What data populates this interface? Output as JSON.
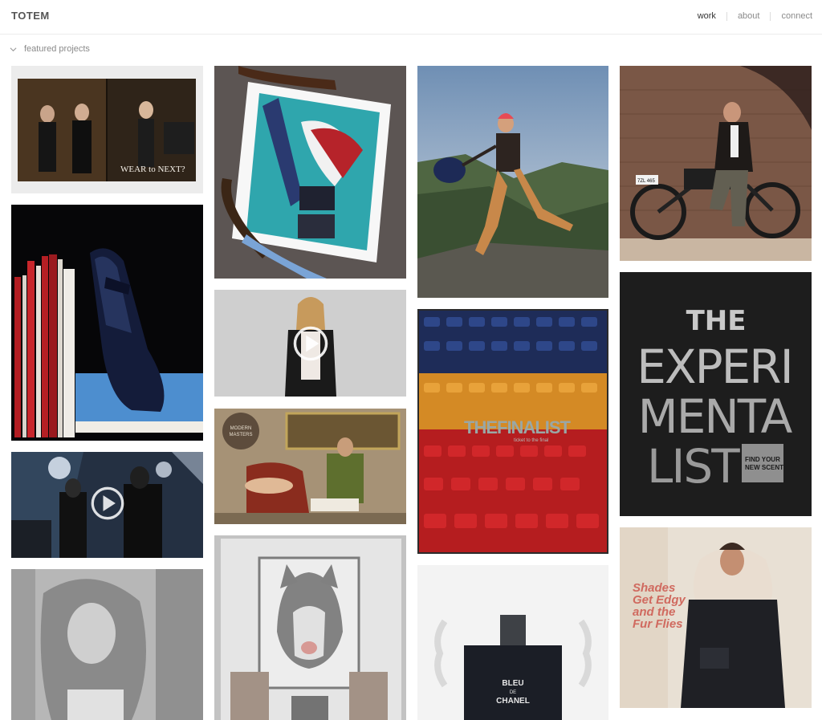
{
  "brand": {
    "logo": "TOTEM"
  },
  "nav": {
    "items": [
      "work",
      "about",
      "connect"
    ],
    "active_color": "#333333",
    "inactive_color": "#8a8a8a"
  },
  "section": {
    "label": "featured projects",
    "icon": "chevron-down-icon"
  },
  "tiles": {
    "magazine_text": "WEAR to NEXT?",
    "finalist_main": "THEFINALIST",
    "finalist_sub": "ticket to the final",
    "exp_line1": "THE",
    "exp_line2": "EXPERI",
    "exp_line3": "MENTA",
    "exp_line4": "LIST",
    "exp_badge1": "FIND YOUR",
    "exp_badge2": "NEW SCENT",
    "masters_text1": "MODERN",
    "masters_text2": "MASTERS",
    "chanel_line1": "BLEU",
    "chanel_line2": "DE",
    "chanel_line3": "CHANEL",
    "moto_plate": "7ZL 465",
    "shades_line1": "Shades",
    "shades_line2": "Get Edgy",
    "shades_line3": "and the",
    "shades_line4": "Fur Flies"
  }
}
